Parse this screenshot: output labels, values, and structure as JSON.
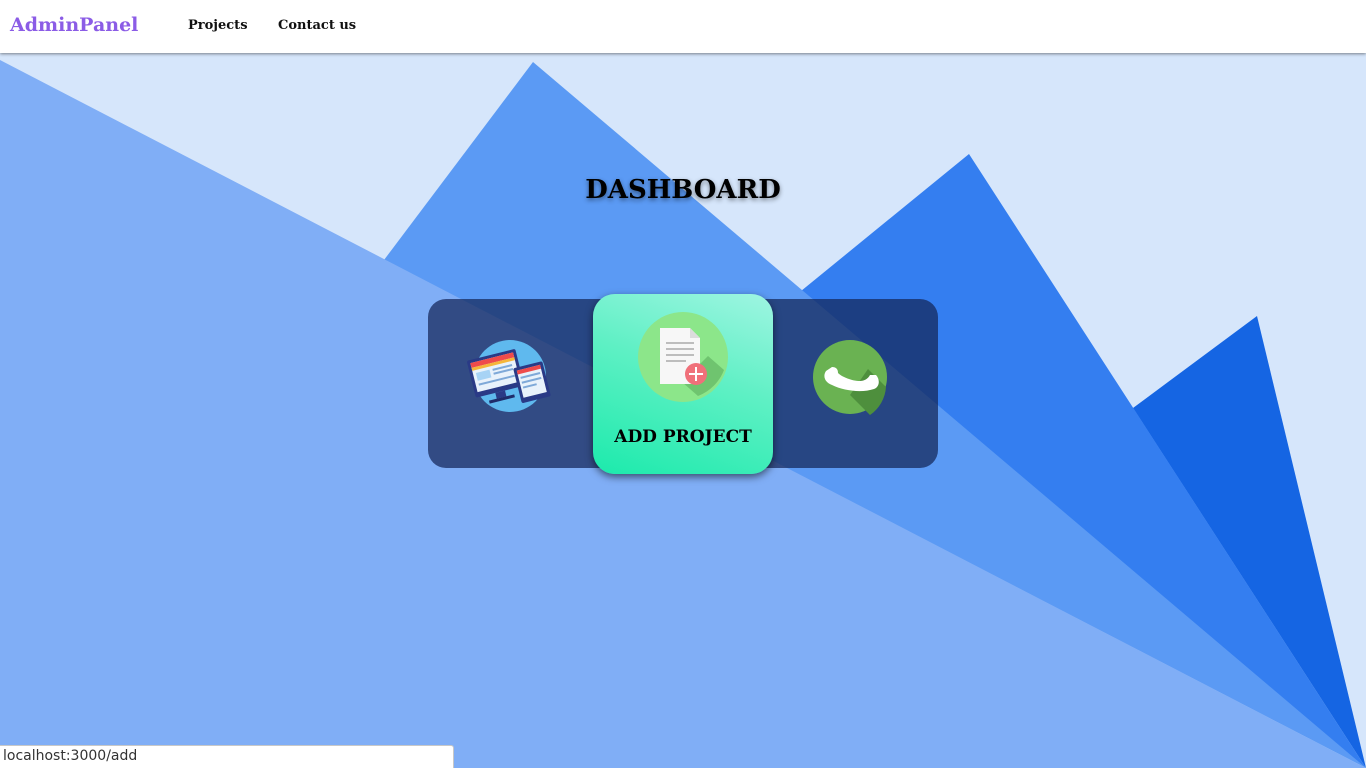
{
  "app": {
    "brand": "AdminPanel"
  },
  "nav": {
    "items": [
      {
        "label": "Projects"
      },
      {
        "label": "Contact us"
      }
    ]
  },
  "main": {
    "title": "DASHBOARD",
    "menu": [
      {
        "icon": "projects-screens-icon"
      },
      {
        "icon": "add-document-icon",
        "label": "ADD PROJECT",
        "active": true
      },
      {
        "icon": "phone-icon"
      }
    ]
  },
  "status_bar": {
    "url": "localhost:3000/add"
  },
  "colors": {
    "brand": "#8b5ce6",
    "background_light": "#d6e6fb",
    "triangle_blue_1": "#5b9af4",
    "triangle_blue_2": "#347ef0",
    "triangle_blue_3": "#1565e3",
    "front_blue": "#80aef6",
    "card_gradient_start": "#9ff5e2",
    "card_gradient_end": "#1ceaac"
  }
}
